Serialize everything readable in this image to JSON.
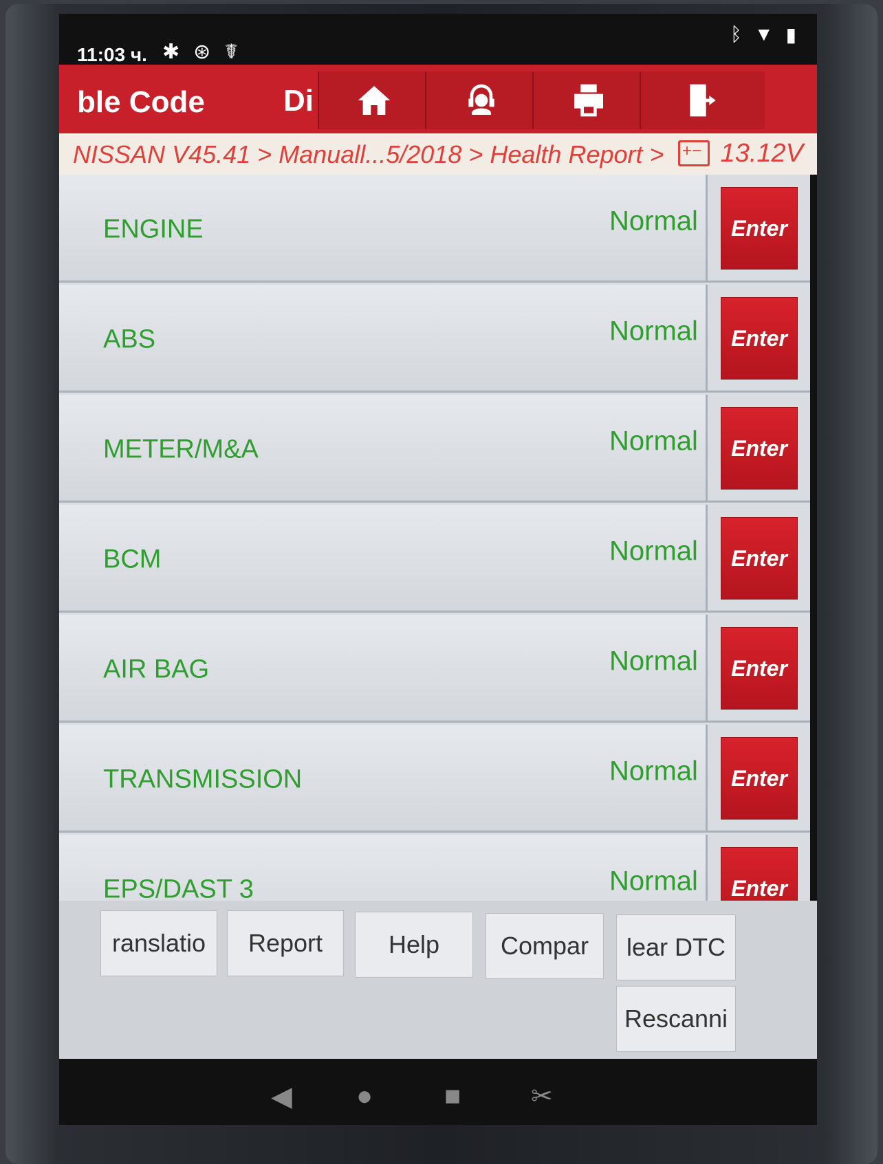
{
  "status": {
    "time": "11:03 ч.",
    "left_icons": [
      "gear-icon",
      "bluetooth-circle-icon",
      "stethoscope-icon"
    ],
    "right_icons": [
      "bluetooth-icon",
      "wifi-icon",
      "battery-icon"
    ]
  },
  "appbar": {
    "title": "ble Code",
    "title2": "Di",
    "buttons": [
      {
        "name": "home-icon"
      },
      {
        "name": "support-agent-icon"
      },
      {
        "name": "print-icon"
      },
      {
        "name": "exit-icon"
      }
    ]
  },
  "breadcrumb": {
    "path": "NISSAN V45.41 > Manuall...5/2018 > Health Report >",
    "voltage": "13.12V"
  },
  "systems": [
    {
      "name": "ENGINE",
      "status": "Normal",
      "action": "Enter"
    },
    {
      "name": "ABS",
      "status": "Normal",
      "action": "Enter"
    },
    {
      "name": "METER/M&A",
      "status": "Normal",
      "action": "Enter"
    },
    {
      "name": "BCM",
      "status": "Normal",
      "action": "Enter"
    },
    {
      "name": "AIR BAG",
      "status": "Normal",
      "action": "Enter"
    },
    {
      "name": "TRANSMISSION",
      "status": "Normal",
      "action": "Enter"
    },
    {
      "name": "EPS/DAST 3",
      "status": "Normal",
      "action": "Enter"
    }
  ],
  "actions": {
    "translation": "ranslatio",
    "report": "Report",
    "help": "Help",
    "compare": "Compar",
    "clear_dtc": "lear DTC",
    "rescanning": "Rescanni"
  },
  "colors": {
    "brand_red": "#c8202a",
    "status_green": "#2f9e2f",
    "breadcrumb_red": "#e0403a"
  }
}
